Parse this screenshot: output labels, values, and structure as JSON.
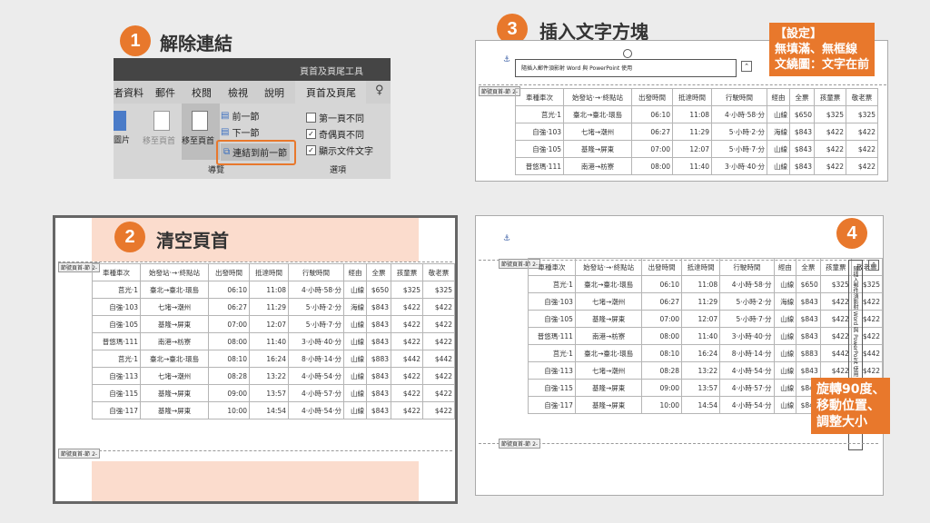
{
  "steps": [
    {
      "num": "1",
      "title": "解除連結"
    },
    {
      "num": "2",
      "title": "清空頁首"
    },
    {
      "num": "3",
      "title": "插入文字方塊"
    },
    {
      "num": "4",
      "title": ""
    }
  ],
  "ribbon": {
    "context_title": "頁首及頁尾工具",
    "tabs": [
      "者資料",
      "郵件",
      "校閱",
      "檢視",
      "說明",
      "頁首及頁尾"
    ],
    "btn_prev_header": "移至頁首",
    "btn_goto_header": "移至頁首",
    "btn_pic": "圖片",
    "nav_prev": "前一節",
    "nav_next": "下一節",
    "nav_link": "連結到前一節",
    "group_nav": "導覽",
    "group_options": "選項",
    "opt1": "第一頁不同",
    "opt2": "奇偶頁不同",
    "opt3": "顯示文件文字"
  },
  "callout_settings": "【設定】\n無填滿、無框線\n文繞圖：文字在前",
  "callout_rotate": "旋轉90度、\n移動位置、\n調整大小",
  "textbox_text": "隨插入郵件須影射 Word 與 PowerPoint 使用",
  "header_tag": "節號頁首‑節 2‑",
  "table": {
    "headers": [
      "車種車次",
      "始發站·→·終點站",
      "出發時間",
      "抵達時間",
      "行駛時間",
      "經由",
      "全票",
      "孩童票",
      "敬老票"
    ],
    "rows": [
      [
        "莒光·1",
        "臺北→臺北-環島",
        "06:10",
        "11:08",
        "4·小時·58·分",
        "山線",
        "$650",
        "$325",
        "$325"
      ],
      [
        "自強·103",
        "七堵→潮州",
        "06:27",
        "11:29",
        "5·小時·2·分",
        "海線",
        "$843",
        "$422",
        "$422"
      ],
      [
        "自強·105",
        "基隆→屏東",
        "07:00",
        "12:07",
        "5·小時·7·分",
        "山線",
        "$843",
        "$422",
        "$422"
      ],
      [
        "普悠瑪·111",
        "南港→枋寮",
        "08:00",
        "11:40",
        "3·小時·40·分",
        "山線",
        "$843",
        "$422",
        "$422"
      ],
      [
        "莒光·1",
        "臺北→臺北-環島",
        "08:10",
        "16:24",
        "8·小時·14·分",
        "山線",
        "$883",
        "$442",
        "$442"
      ],
      [
        "自強·113",
        "七堵→潮州",
        "08:28",
        "13:22",
        "4·小時·54·分",
        "山線",
        "$843",
        "$422",
        "$422"
      ],
      [
        "自強·115",
        "基隆→屏東",
        "09:00",
        "13:57",
        "4·小時·57·分",
        "山線",
        "$843",
        "$422",
        "$422"
      ],
      [
        "自強·117",
        "基隆→屏東",
        "10:00",
        "14:54",
        "4·小時·54·分",
        "山線",
        "$843",
        "$422",
        "$422"
      ]
    ]
  }
}
